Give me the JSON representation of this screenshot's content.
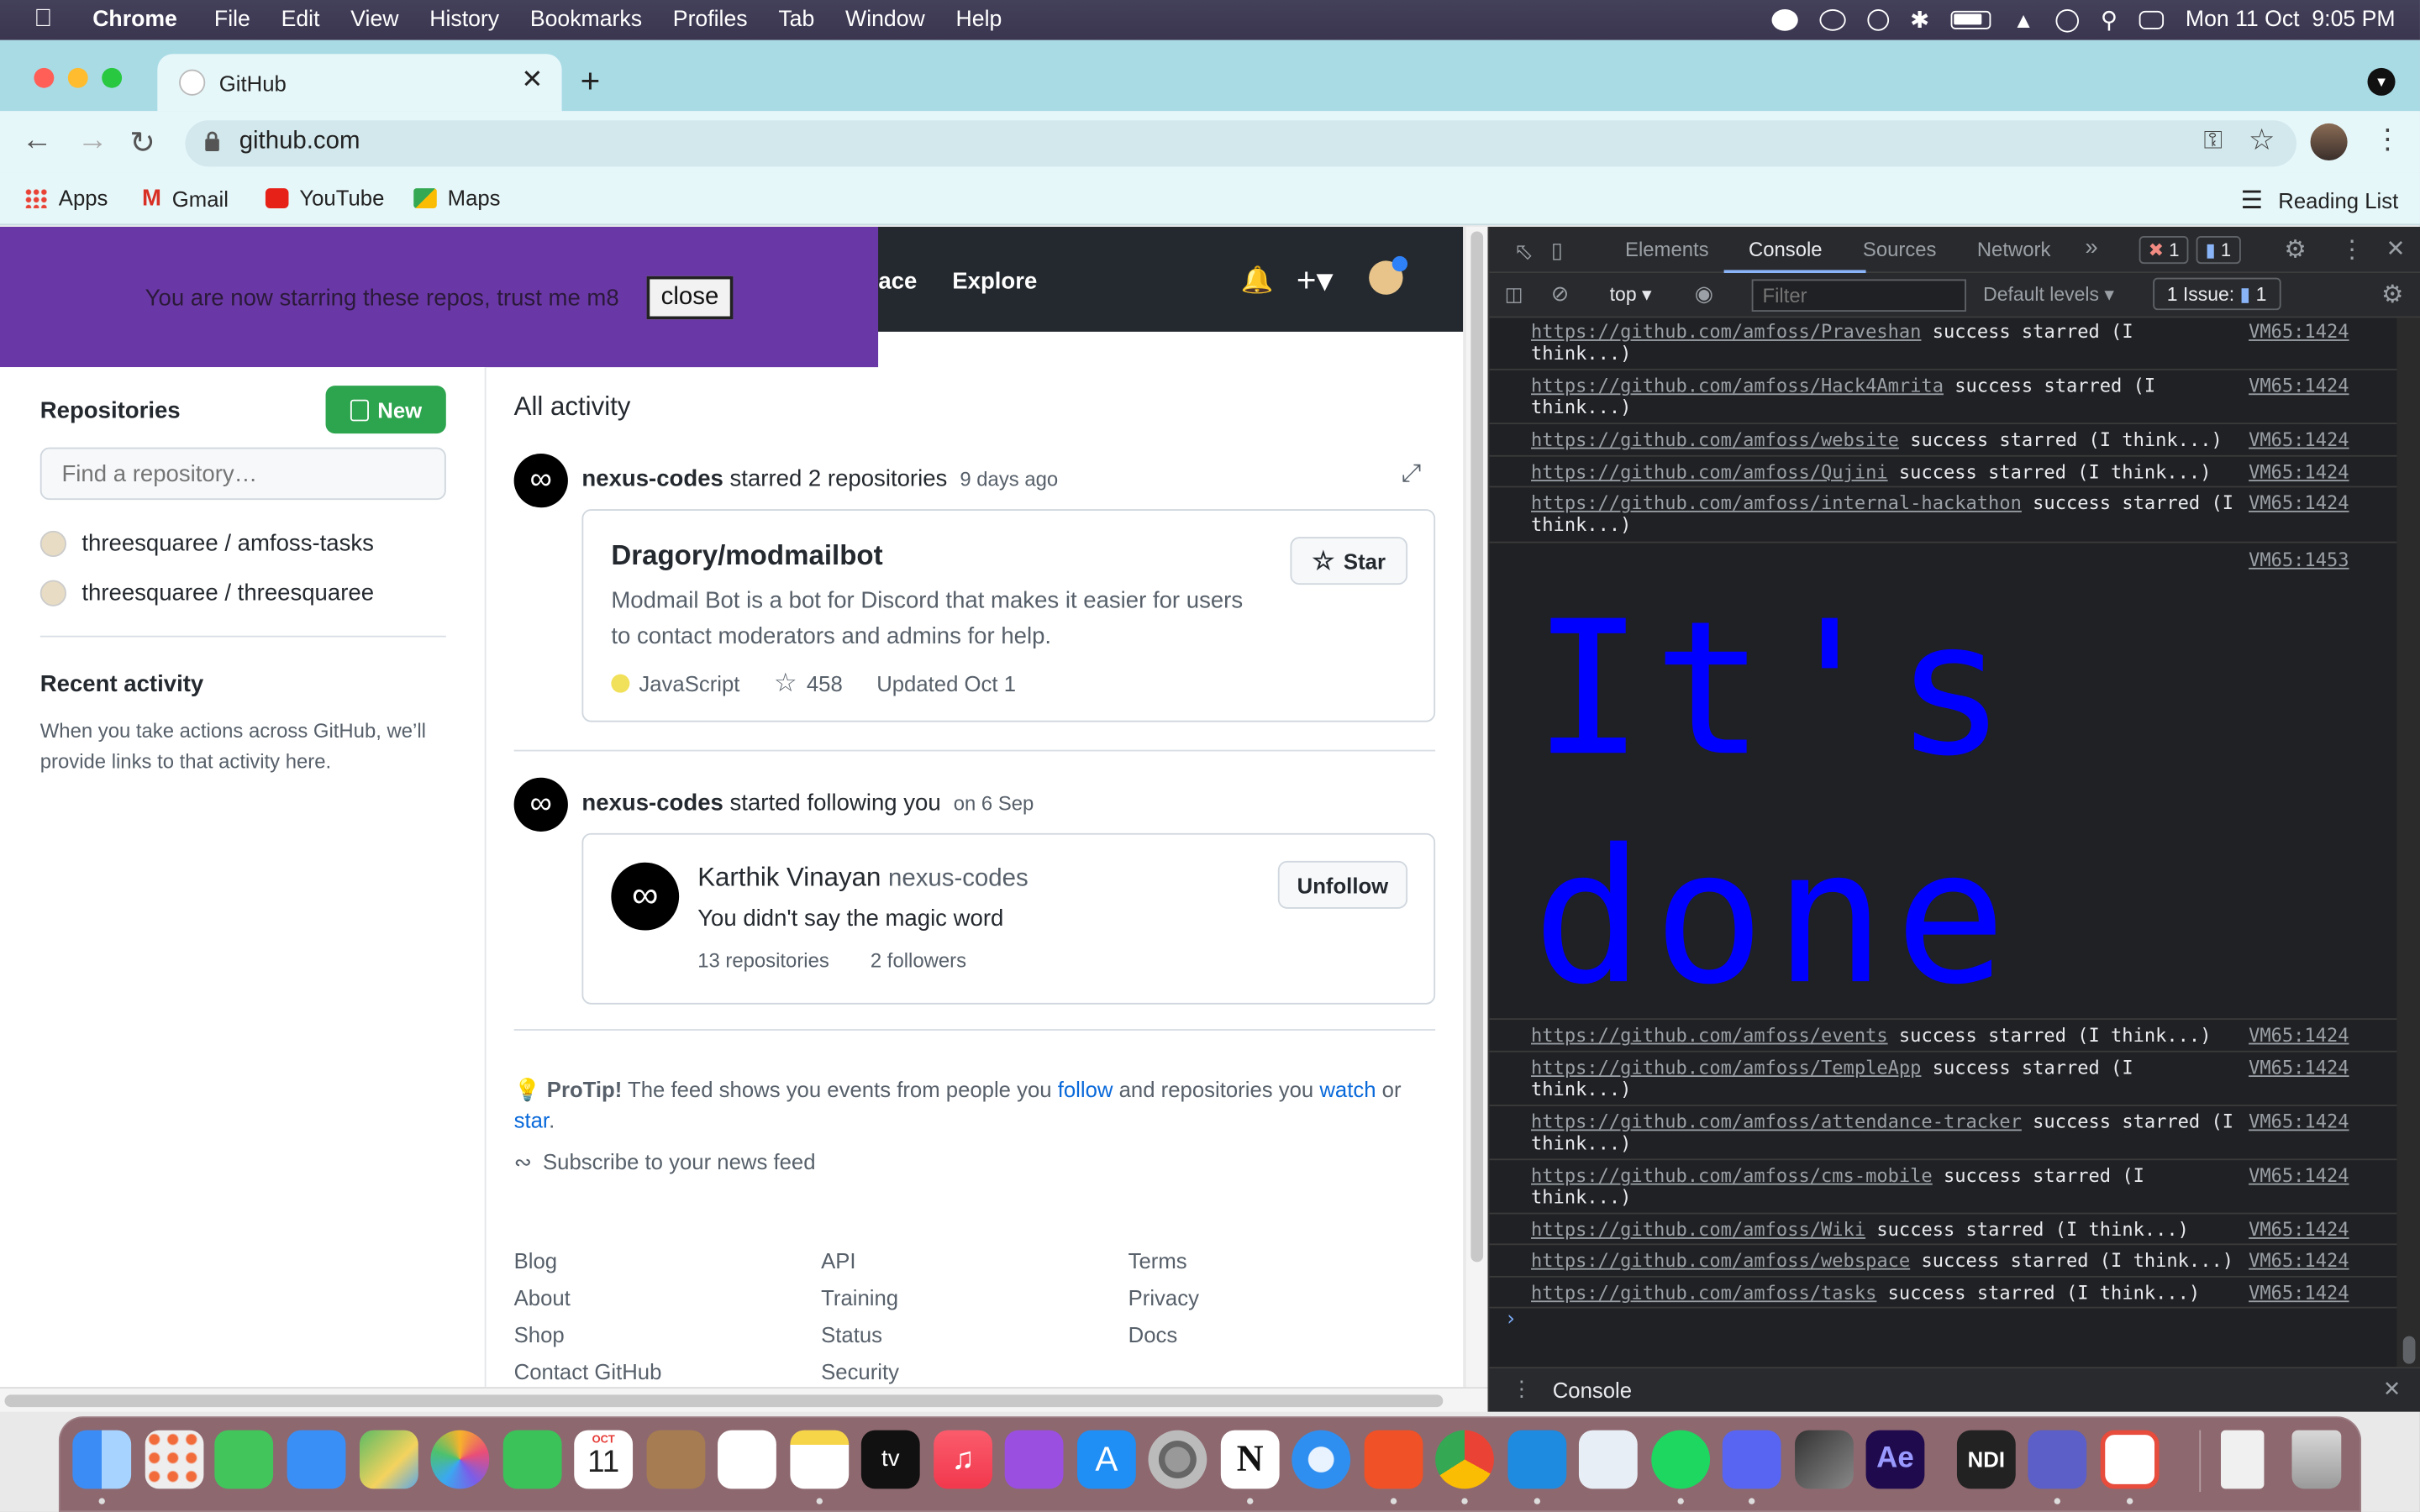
{
  "menubar": {
    "app": "Chrome",
    "items": [
      "File",
      "Edit",
      "View",
      "History",
      "Bookmarks",
      "Profiles",
      "Tab",
      "Window",
      "Help"
    ],
    "clock": "Mon 11 Oct  9:05 PM"
  },
  "tab": {
    "title": "GitHub",
    "close": "✕",
    "new": "+"
  },
  "toolbar": {
    "url": "github.com"
  },
  "bookmarks": {
    "items": [
      "Apps",
      "Gmail",
      "YouTube",
      "Maps"
    ],
    "reading_list": "Reading List"
  },
  "github": {
    "banner_message": "You are now starring these repos, trust me m8",
    "banner_close": "close",
    "nav_partial": "lace",
    "nav_explore": "Explore",
    "sidebar": {
      "repositories_heading": "Repositories",
      "new_button": "New",
      "find_placeholder": "Find a repository…",
      "repos": [
        "threesquaree / amfoss-tasks",
        "threesquaree / threesquaree"
      ],
      "recent_heading": "Recent activity",
      "recent_desc": "When you take actions across GitHub, we’ll provide links to that activity here."
    },
    "feed": {
      "heading": "All activity",
      "event1": {
        "user": "nexus-codes",
        "action": "starred 2 repositories",
        "time": "9 days ago",
        "repo_name": "Dragory/modmailbot",
        "repo_desc": "Modmail Bot is a bot for Discord that makes it easier for users to contact moderators and admins for help.",
        "language": "JavaScript",
        "stars": "458",
        "updated": "Updated Oct 1",
        "star_button": "Star"
      },
      "event2": {
        "user": "nexus-codes",
        "action": "started following you",
        "time": "on 6 Sep",
        "name": "Karthik Vinayan",
        "handle": "nexus-codes",
        "bio": "You didn't say the magic word",
        "repos": "13 repositories",
        "followers": "2 followers",
        "unfollow_button": "Unfollow"
      },
      "protip_label": "ProTip!",
      "protip_text1": "The feed shows you events from people you",
      "protip_follow": "follow",
      "protip_text2": "and repositories you",
      "protip_watch": "watch",
      "protip_or": "or",
      "protip_star": "star",
      "protip_dot": ".",
      "subscribe": "Subscribe to your news feed"
    },
    "footer": {
      "col1": [
        "Blog",
        "About",
        "Shop",
        "Contact GitHub"
      ],
      "col2": [
        "API",
        "Training",
        "Status",
        "Security"
      ],
      "col3": [
        "Terms",
        "Privacy",
        "Docs"
      ]
    }
  },
  "devtools": {
    "tabs": [
      "Elements",
      "Console",
      "Sources",
      "Network"
    ],
    "more": "»",
    "errors": "1",
    "messages": "1",
    "context": "top",
    "filter_placeholder": "Filter",
    "levels": "Default levels",
    "issues": "1 Issue:",
    "issues_count": "1",
    "logs_before": [
      {
        "url": "https://github.com/amfoss/Praveshan",
        "msg": "success starred (I think...)",
        "src": "VM65:1424"
      },
      {
        "url": "https://github.com/amfoss/Hack4Amrita",
        "msg": "success starred (I think...)",
        "src": "VM65:1424"
      },
      {
        "url": "https://github.com/amfoss/website",
        "msg": "success starred (I think...)",
        "src": "VM65:1424"
      },
      {
        "url": "https://github.com/amfoss/Qujini",
        "msg": "success starred (I think...)",
        "src": "VM65:1424"
      },
      {
        "url": "https://github.com/amfoss/internal-hackathon",
        "msg": "success starred (I think...)",
        "src": "VM65:1424"
      }
    ],
    "big_src": "VM65:1453",
    "big_line1": "It's",
    "big_line2": "done",
    "logs_after": [
      {
        "url": "https://github.com/amfoss/events",
        "msg": "success starred (I think...)",
        "src": "VM65:1424"
      },
      {
        "url": "https://github.com/amfoss/TempleApp",
        "msg": "success starred (I think...)",
        "src": "VM65:1424"
      },
      {
        "url": "https://github.com/amfoss/attendance-tracker",
        "msg": "success starred (I think...)",
        "src": "VM65:1424"
      },
      {
        "url": "https://github.com/amfoss/cms-mobile",
        "msg": "success starred (I think...)",
        "src": "VM65:1424"
      },
      {
        "url": "https://github.com/amfoss/Wiki",
        "msg": "success starred (I think...)",
        "src": "VM65:1424"
      },
      {
        "url": "https://github.com/amfoss/webspace",
        "msg": "success starred (I think...)",
        "src": "VM65:1424"
      },
      {
        "url": "https://github.com/amfoss/tasks",
        "msg": "success starred (I think...)",
        "src": "VM65:1424"
      }
    ],
    "prompt": "›",
    "drawer_tab": "Console"
  },
  "dock": {
    "calendar_month": "OCT",
    "calendar_day": "11",
    "tv_label": "tv",
    "ae_label": "Ae",
    "ndi_label": "NDI",
    "notion_label": "N"
  },
  "colors": {
    "console_big_text": "#0000ff",
    "banner": "#6a37a6",
    "gh_green": "#2da44e"
  }
}
